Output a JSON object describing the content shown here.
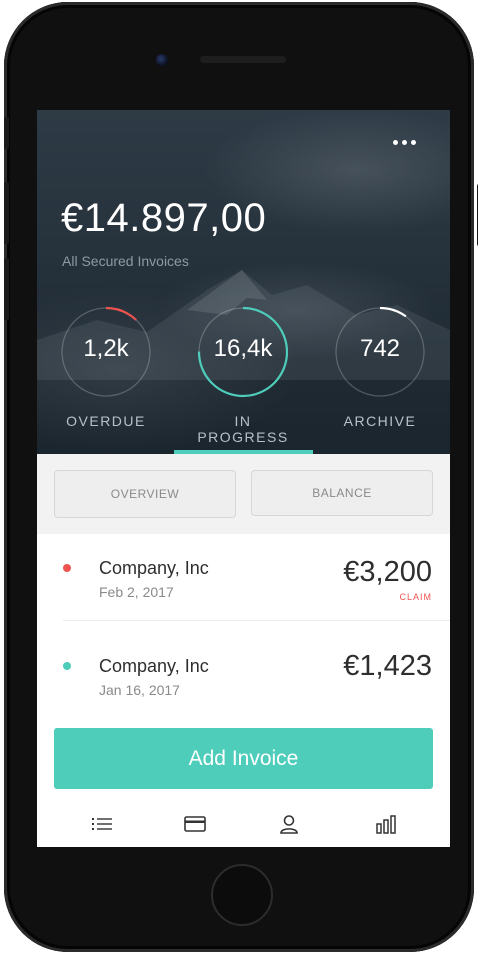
{
  "header": {
    "total_amount": "€14.897,00",
    "total_caption": "All Secured Invoices",
    "menu_icon": "more-horizontal-icon"
  },
  "stats": [
    {
      "value": "1,2k",
      "label": "OVERDUE",
      "ring_color": "#ef5350",
      "progress": 0.12
    },
    {
      "value": "16,4k",
      "label": "IN PROGRESS",
      "ring_color": "#4ecdbb",
      "progress": 0.75
    },
    {
      "value": "742",
      "label": "ARCHIVE",
      "ring_color": "#ffffff",
      "progress": 0.1
    }
  ],
  "active_stat": "IN PROGRESS",
  "segments": {
    "overview": "OVERVIEW",
    "balance": "BALANCE"
  },
  "invoices": [
    {
      "company": "Company, Inc",
      "date": "Feb 2, 2017",
      "amount": "€3,200",
      "status": "CLAIM",
      "dot_color": "#ef5350"
    },
    {
      "company": "Company, Inc",
      "date": "Jan 16, 2017",
      "amount": "€1,423",
      "status": "",
      "dot_color": "#4ecdbb"
    }
  ],
  "actions": {
    "add_invoice": "Add Invoice"
  },
  "tabbar": [
    {
      "icon": "list-icon"
    },
    {
      "icon": "credit-card-icon"
    },
    {
      "icon": "user-icon"
    },
    {
      "icon": "bar-chart-icon"
    }
  ],
  "colors": {
    "accent": "#4ecdbb",
    "alert": "#ef5350"
  }
}
